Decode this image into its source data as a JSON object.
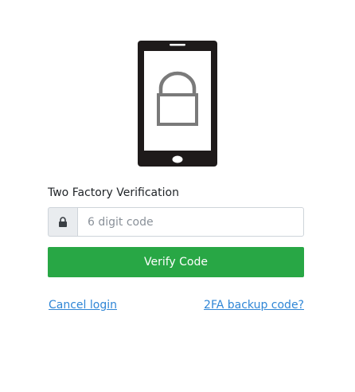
{
  "form": {
    "label": "Two Factory Verification",
    "code_placeholder": "6 digit code",
    "code_value": "",
    "verify_label": "Verify Code"
  },
  "links": {
    "cancel_label": "Cancel login",
    "backup_label": "2FA backup code?"
  },
  "icons": {
    "hero": "phone-lock-icon",
    "input_addon": "lock-icon"
  },
  "colors": {
    "primary_button": "#28a745",
    "link": "#2f86d6",
    "addon_bg": "#e9ecef"
  }
}
